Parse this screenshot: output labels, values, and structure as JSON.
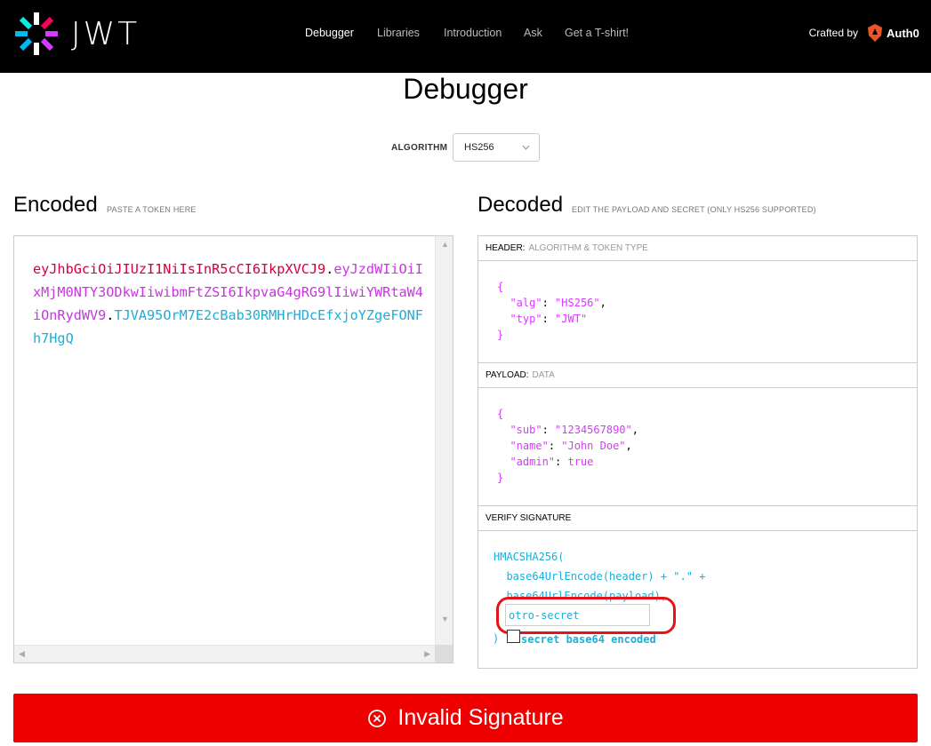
{
  "brand": {
    "logo_text": "JWT"
  },
  "nav": {
    "items": [
      "Debugger",
      "Libraries",
      "Introduction",
      "Ask",
      "Get a T-shirt!"
    ],
    "active": "Debugger"
  },
  "crafted": {
    "label": "Crafted by",
    "brand": "Auth0"
  },
  "page": {
    "title": "Debugger"
  },
  "algorithm": {
    "label": "ALGORITHM",
    "value": "HS256"
  },
  "encoded": {
    "title": "Encoded",
    "subtitle": "PASTE A TOKEN HERE",
    "token": {
      "header": "eyJhbGciOiJIUzI1NiIsInR5cCI6IkpXVCJ9",
      "payload": "eyJzdWIiOiIxMjM0NTY3ODkwIiwibmFtZSI6IkpvaG4gRG9lIiwiYWRtaW4iOnRydWV9",
      "signature": "TJVA95OrM7E2cBab30RMHrHDcEfxjoYZgeFONFh7HgQ"
    }
  },
  "decoded": {
    "title": "Decoded",
    "subtitle": "EDIT THE PAYLOAD AND SECRET (ONLY HS256 SUPPORTED)",
    "header_section": {
      "label": "HEADER:",
      "sublabel": "ALGORITHM & TOKEN TYPE"
    },
    "header_json": {
      "alg": "HS256",
      "typ": "JWT"
    },
    "payload_section": {
      "label": "PAYLOAD:",
      "sublabel": "DATA"
    },
    "payload_json": {
      "sub": "1234567890",
      "name": "John Doe",
      "admin": "true"
    },
    "verify_section": {
      "label": "VERIFY SIGNATURE"
    },
    "verify": {
      "fn": "HMACSHA256(",
      "line1": "base64UrlEncode(header) + \".\" +",
      "line2": "base64UrlEncode(payload),",
      "secret_value": "otro-secret",
      "close": ")",
      "b64_label": "secret base64 encoded"
    }
  },
  "status": {
    "text": "Invalid Signature",
    "color": "#ef0000"
  },
  "colors": {
    "header": "#d4003b",
    "payload": "#c736e0",
    "signature": "#1eaed6"
  }
}
